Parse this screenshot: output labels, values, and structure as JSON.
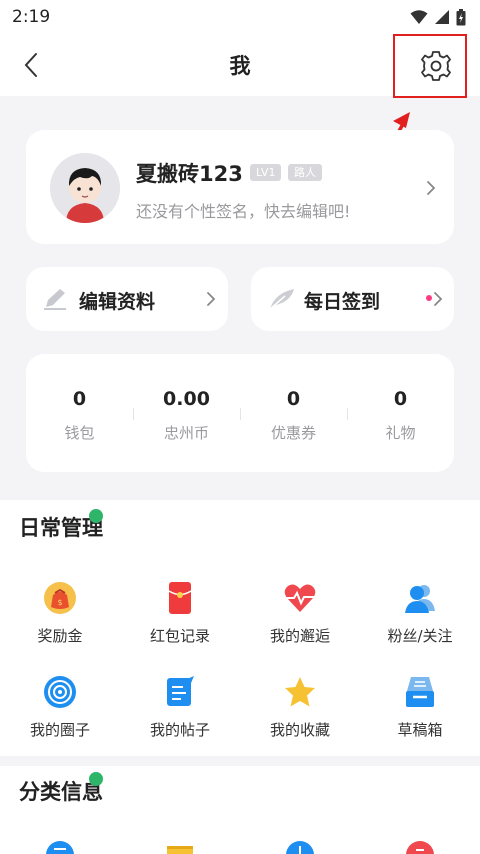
{
  "status_bar": {
    "time": "2:19"
  },
  "header": {
    "title": "我"
  },
  "profile": {
    "username": "夏搬砖123",
    "level_badge": "LV1",
    "role_badge": "路人",
    "signature": "还没有个性签名，快去编辑吧!"
  },
  "actions": {
    "edit_profile": "编辑资料",
    "daily_checkin": "每日签到"
  },
  "stats": [
    {
      "value": "0",
      "label": "钱包"
    },
    {
      "value": "0.00",
      "label": "忠州币"
    },
    {
      "value": "0",
      "label": "优惠券"
    },
    {
      "value": "0",
      "label": "礼物"
    }
  ],
  "daily_management": {
    "title": "日常管理",
    "items": [
      {
        "label": "奖励金",
        "icon": "money-bag-icon"
      },
      {
        "label": "红包记录",
        "icon": "red-envelope-icon"
      },
      {
        "label": "我的邂逅",
        "icon": "heartbeat-icon"
      },
      {
        "label": "粉丝/关注",
        "icon": "followers-icon"
      },
      {
        "label": "我的圈子",
        "icon": "circle-target-icon"
      },
      {
        "label": "我的帖子",
        "icon": "post-edit-icon"
      },
      {
        "label": "我的收藏",
        "icon": "star-icon"
      },
      {
        "label": "草稿箱",
        "icon": "draft-box-icon"
      }
    ]
  },
  "category_info": {
    "title": "分类信息"
  },
  "colors": {
    "highlight": "#e21f1f",
    "accent_blue": "#1e8ff0",
    "badge_green": "#2fb56a",
    "checkin_dot": "#ff3c82"
  }
}
